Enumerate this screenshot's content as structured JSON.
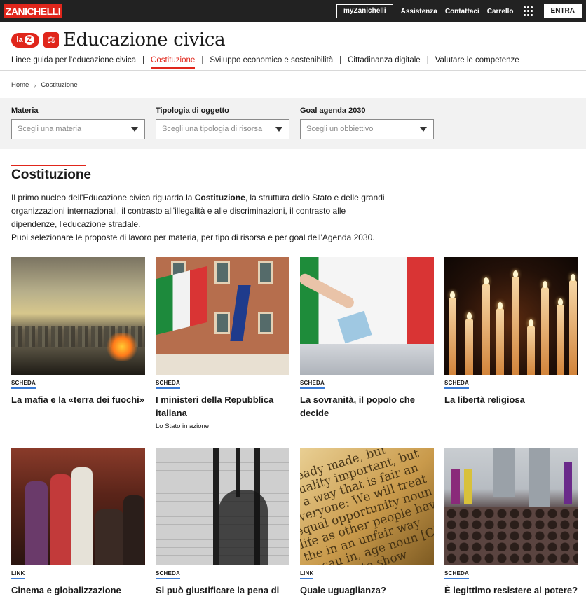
{
  "topbar": {
    "logo": "ZANICHELLI",
    "my_button": "myZanichelli",
    "links": [
      "Assistenza",
      "Contattaci",
      "Carrello"
    ],
    "login_button": "ENTRA",
    "apps_icon": "grid-icon"
  },
  "header": {
    "laz_label": "la",
    "laz_letter": "Z",
    "title": "Educazione civica"
  },
  "nav": {
    "items": [
      "Linee guida per l'educazione civica",
      "Costituzione",
      "Sviluppo economico e sostenibilità",
      "Cittadinanza digitale",
      "Valutare le competenze"
    ],
    "active_index": 1
  },
  "breadcrumb": {
    "home": "Home",
    "current": "Costituzione"
  },
  "filters": [
    {
      "label": "Materia",
      "placeholder": "Scegli una materia"
    },
    {
      "label": "Tipologia di oggetto",
      "placeholder": "Scegli una tipologia di risorsa"
    },
    {
      "label": "Goal agenda 2030",
      "placeholder": "Scegli un obbiettivo"
    }
  ],
  "section": {
    "title": "Costituzione",
    "intro_before": "Il primo nucleo dell'Educazione civica riguarda la ",
    "intro_bold": "Costituzione",
    "intro_after": ", la struttura dello Stato e delle grandi organizzazioni internazionali, il contrasto all'illegalità e alle discriminazioni, il contrasto alle dipendenze, l'educazione stradale.",
    "intro_line2": "Puoi selezionare le proposte di lavoro per materia, per tipo di risorsa e per goal dell'Agenda 2030."
  },
  "cards": [
    {
      "tag": "SCHEDA",
      "title": "La mafia e la «terra dei fuochi»",
      "subtitle": ""
    },
    {
      "tag": "SCHEDA",
      "title": "I ministeri della Repubblica italiana",
      "subtitle": "Lo Stato in azione"
    },
    {
      "tag": "SCHEDA",
      "title": "La sovranità, il popolo che decide",
      "subtitle": ""
    },
    {
      "tag": "SCHEDA",
      "title": "La libertà religiosa",
      "subtitle": ""
    },
    {
      "tag": "LINK",
      "title": "Cinema e globalizzazione",
      "subtitle": ""
    },
    {
      "tag": "SCHEDA",
      "title": "Si può giustificare la pena di",
      "subtitle": ""
    },
    {
      "tag": "LINK",
      "title": "Quale uguaglianza?",
      "subtitle": ""
    },
    {
      "tag": "SCHEDA",
      "title": "È legittimo resistere al potere?",
      "subtitle": ""
    }
  ],
  "thumb_text": "already made, but equality important, but in a way that is fair an everyone: We will treat equal opportunity noun life as other people have the in an unfair way becau in, age noun [C] the sign to show",
  "colors": {
    "brand_red": "#e0261b",
    "tag_underline": "#3a7bd5",
    "topbar": "#222222"
  }
}
